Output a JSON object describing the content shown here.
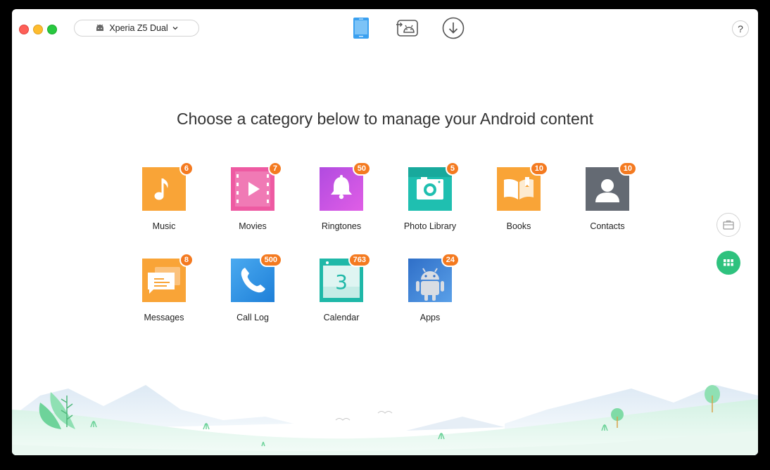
{
  "window": {
    "device_selector": {
      "label": "Xperia Z5 Dual",
      "icon": "android-icon"
    },
    "toolbar": [
      {
        "name": "device-manager-tab",
        "icon": "phone-icon",
        "active": true
      },
      {
        "name": "android-mover-tab",
        "icon": "android-transfer-icon",
        "active": false
      },
      {
        "name": "downloader-tab",
        "icon": "download-icon",
        "active": false
      }
    ],
    "help_label": "?"
  },
  "main": {
    "headline": "Choose a category below to manage your Android content",
    "categories": [
      {
        "label": "Music",
        "count": "6",
        "icon": "music-note-icon",
        "color": "#f7931e"
      },
      {
        "label": "Movies",
        "count": "7",
        "icon": "film-icon",
        "color": "#ec4f9a"
      },
      {
        "label": "Ringtones",
        "count": "50",
        "icon": "bell-icon",
        "color": "#c653e6"
      },
      {
        "label": "Photo Library",
        "count": "5",
        "icon": "camera-icon",
        "color": "#1fbfb0"
      },
      {
        "label": "Books",
        "count": "10",
        "icon": "book-icon",
        "color": "#f7931e"
      },
      {
        "label": "Contacts",
        "count": "10",
        "icon": "contact-icon",
        "color": "#646a73"
      },
      {
        "label": "Messages",
        "count": "8",
        "icon": "message-icon",
        "color": "#f7931e"
      },
      {
        "label": "Call Log",
        "count": "500",
        "icon": "phone-handset-icon",
        "color": "#2c8fe6"
      },
      {
        "label": "Calendar",
        "count": "763",
        "icon": "calendar-icon",
        "color": "#1fb8a8",
        "day": "3"
      },
      {
        "label": "Apps",
        "count": "24",
        "icon": "android-icon",
        "color": "#3d7fd6"
      }
    ]
  },
  "sidebar": {
    "buttons": [
      {
        "name": "toolkit-button",
        "icon": "toolbox-icon"
      },
      {
        "name": "categories-button",
        "icon": "grid-icon",
        "active": true
      }
    ]
  },
  "colors": {
    "accent": "#2ec27e",
    "badge": "#f47a20",
    "active_tab": "#3aa0f0"
  }
}
